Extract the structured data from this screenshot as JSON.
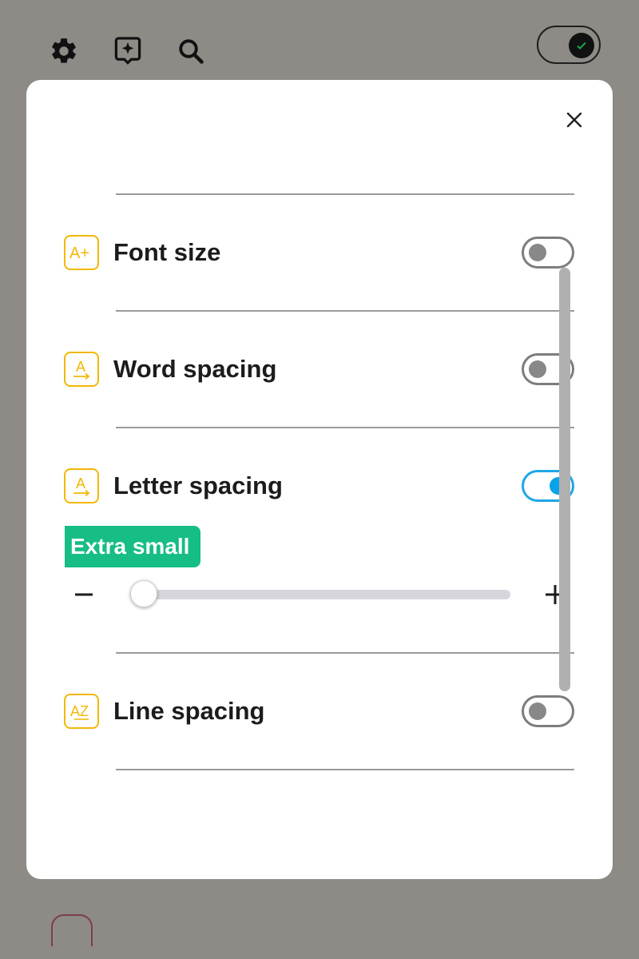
{
  "background": {
    "toolbar_icons": [
      "gear-icon",
      "sparkle-badge-icon",
      "search-icon"
    ],
    "dark_mode_toggle": {
      "state": "on"
    },
    "colors": {
      "overlay": "#8e8a86"
    }
  },
  "modal": {
    "close_icon": "close-icon",
    "settings": [
      {
        "id": "font-size",
        "icon": "font-size-icon",
        "icon_text": "A+",
        "label": "Font size",
        "enabled": false
      },
      {
        "id": "word-spacing",
        "icon": "word-spacing-icon",
        "icon_text": "A",
        "label": "Word spacing",
        "enabled": false
      },
      {
        "id": "letter-spacing",
        "icon": "letter-spacing-icon",
        "icon_text": "A",
        "label": "Letter spacing",
        "enabled": true
      },
      {
        "id": "line-spacing",
        "icon": "line-spacing-icon",
        "icon_text": "AZ",
        "label": "Line spacing",
        "enabled": false
      }
    ],
    "letter_spacing_slider": {
      "value_label": "Extra small",
      "value": 0,
      "min": 0,
      "max": 100,
      "minus_label": "−",
      "plus_label": "+"
    },
    "colors": {
      "accent_icon": "#f2b705",
      "toggle_on": "#1ea7e6",
      "badge": "#16bd84"
    }
  }
}
